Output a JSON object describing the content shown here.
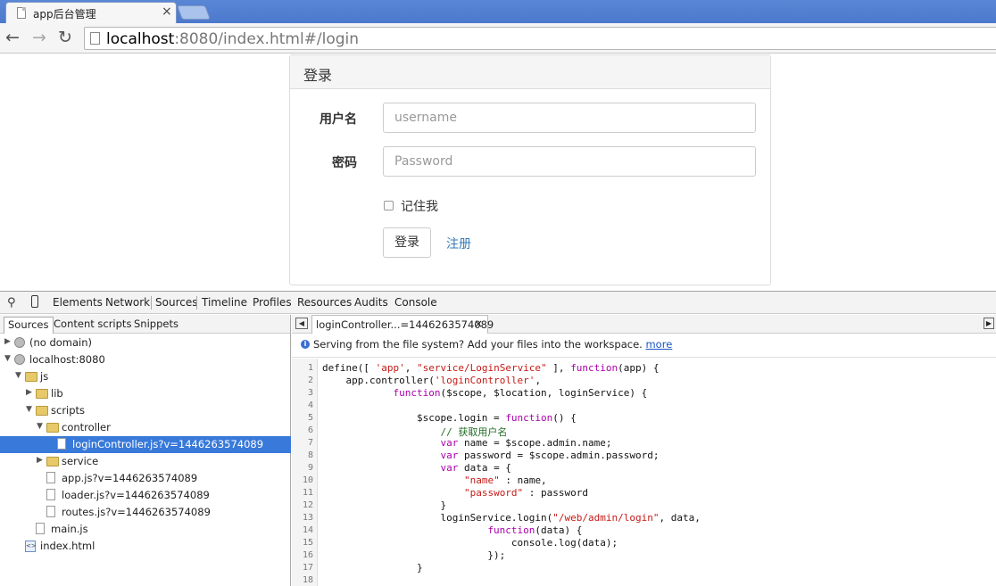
{
  "browser": {
    "tab_title": "app后台管理",
    "url_host": "localhost",
    "url_rest": ":8080/index.html#/login"
  },
  "login": {
    "heading": "登录",
    "username_label": "用户名",
    "username_placeholder": "username",
    "password_label": "密码",
    "password_placeholder": "Password",
    "remember_label": "记住我",
    "login_button": "登录",
    "register_link": "注册"
  },
  "devtools": {
    "panels": [
      "Elements",
      "Network",
      "Sources",
      "Timeline",
      "Profiles",
      "Resources",
      "Audits",
      "Console"
    ],
    "active_panel": "Sources",
    "navigator_tabs": [
      "Sources",
      "Content scripts",
      "Snippets"
    ],
    "tree": [
      {
        "label": "(no domain)",
        "depth": 0,
        "kind": "globe",
        "expanded": false
      },
      {
        "label": "localhost:8080",
        "depth": 0,
        "kind": "globe",
        "expanded": true
      },
      {
        "label": "js",
        "depth": 1,
        "kind": "folder",
        "expanded": true
      },
      {
        "label": "lib",
        "depth": 2,
        "kind": "folder",
        "expanded": false
      },
      {
        "label": "scripts",
        "depth": 2,
        "kind": "folder",
        "expanded": true
      },
      {
        "label": "controller",
        "depth": 3,
        "kind": "folder",
        "expanded": true
      },
      {
        "label": "loginController.js?v=1446263574089",
        "depth": 4,
        "kind": "file",
        "selected": true
      },
      {
        "label": "service",
        "depth": 3,
        "kind": "folder",
        "expanded": false
      },
      {
        "label": "app.js?v=1446263574089",
        "depth": 3,
        "kind": "file"
      },
      {
        "label": "loader.js?v=1446263574089",
        "depth": 3,
        "kind": "file"
      },
      {
        "label": "routes.js?v=1446263574089",
        "depth": 3,
        "kind": "file"
      },
      {
        "label": "main.js",
        "depth": 2,
        "kind": "file"
      },
      {
        "label": "index.html",
        "depth": 1,
        "kind": "html"
      }
    ],
    "editor_tab": "loginController...=1446263574089",
    "info_text": "Serving from the file system? Add your files into the workspace.",
    "info_link": "more",
    "code_lines": [
      "define([ 'app', \"service/LoginService\" ], function(app) {",
      "    app.controller('loginController',",
      "            function($scope, $location, loginService) {",
      "",
      "                $scope.login = function() {",
      "                    // 获取用户名",
      "                    var name = $scope.admin.name;",
      "                    var password = $scope.admin.password;",
      "                    var data = {",
      "                        \"name\" : name,",
      "                        \"password\" : password",
      "                    }",
      "                    loginService.login(\"/web/admin/login\", data,",
      "                            function(data) {",
      "                                console.log(data);",
      "                            });",
      "                }",
      ""
    ]
  }
}
